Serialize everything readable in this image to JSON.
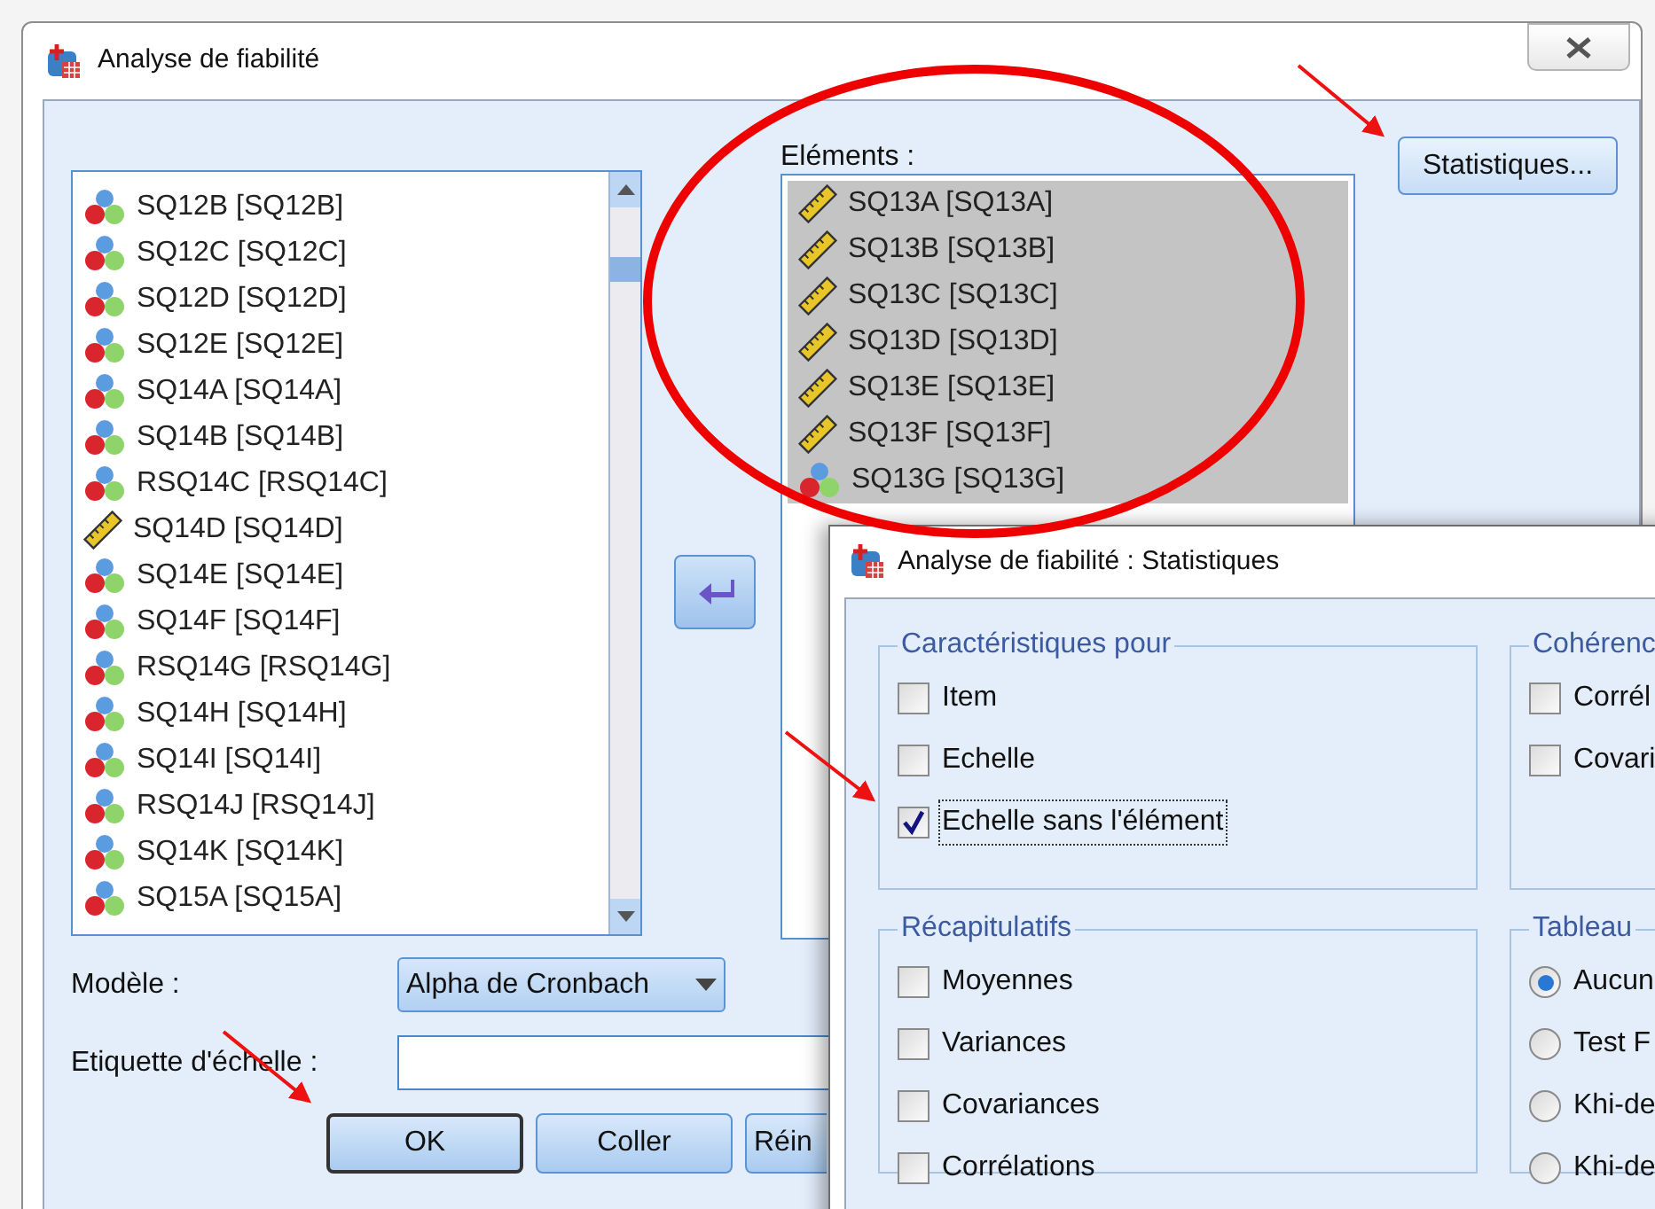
{
  "window": {
    "title": "Analyse de fiabilité"
  },
  "variables": {
    "items": [
      {
        "label": "SQ12B [SQ12B]",
        "kind": "nominal",
        "selected": false
      },
      {
        "label": "SQ12C [SQ12C]",
        "kind": "nominal",
        "selected": false
      },
      {
        "label": "SQ12D [SQ12D]",
        "kind": "nominal",
        "selected": false
      },
      {
        "label": "SQ12E [SQ12E]",
        "kind": "nominal",
        "selected": false
      },
      {
        "label": "SQ14A [SQ14A]",
        "kind": "nominal",
        "selected": false
      },
      {
        "label": "SQ14B [SQ14B]",
        "kind": "nominal",
        "selected": false
      },
      {
        "label": "RSQ14C [RSQ14C]",
        "kind": "nominal",
        "selected": false
      },
      {
        "label": "SQ14D [SQ14D]",
        "kind": "scale",
        "selected": false
      },
      {
        "label": "SQ14E [SQ14E]",
        "kind": "nominal",
        "selected": false
      },
      {
        "label": "SQ14F [SQ14F]",
        "kind": "nominal",
        "selected": false
      },
      {
        "label": "RSQ14G [RSQ14G]",
        "kind": "nominal",
        "selected": false
      },
      {
        "label": "SQ14H [SQ14H]",
        "kind": "nominal",
        "selected": false
      },
      {
        "label": "SQ14I [SQ14I]",
        "kind": "nominal",
        "selected": false
      },
      {
        "label": "RSQ14J [RSQ14J]",
        "kind": "nominal",
        "selected": false
      },
      {
        "label": "SQ14K [SQ14K]",
        "kind": "nominal",
        "selected": false
      },
      {
        "label": "SQ15A [SQ15A]",
        "kind": "nominal",
        "selected": false
      }
    ]
  },
  "elements": {
    "label": "Eléments :",
    "items": [
      {
        "label": "SQ13A [SQ13A]",
        "kind": "scale",
        "selected": true
      },
      {
        "label": "SQ13B [SQ13B]",
        "kind": "scale",
        "selected": true
      },
      {
        "label": "SQ13C [SQ13C]",
        "kind": "scale",
        "selected": true
      },
      {
        "label": "SQ13D [SQ13D]",
        "kind": "scale",
        "selected": true
      },
      {
        "label": "SQ13E [SQ13E]",
        "kind": "scale",
        "selected": true
      },
      {
        "label": "SQ13F [SQ13F]",
        "kind": "scale",
        "selected": true
      },
      {
        "label": "SQ13G [SQ13G]",
        "kind": "nominal",
        "selected": true
      }
    ]
  },
  "statistics_button": "Statistiques...",
  "model": {
    "label": "Modèle :",
    "value": "Alpha de Cronbach"
  },
  "scale_label": {
    "label": "Etiquette d'échelle :"
  },
  "buttons": [
    {
      "label": "OK",
      "default": true
    },
    {
      "label": "Coller",
      "default": false
    },
    {
      "label": "Réin",
      "default": false
    }
  ],
  "statistics_dialog": {
    "title": "Analyse de fiabilité : Statistiques",
    "groups": [
      {
        "title": "Caractéristiques pour",
        "options": [
          {
            "label": "Item",
            "kind": "checkbox",
            "checked": false,
            "focused": false
          },
          {
            "label": "Echelle",
            "kind": "checkbox",
            "checked": false,
            "focused": false
          },
          {
            "label": "Echelle sans l'élément",
            "kind": "checkbox",
            "checked": true,
            "focused": true
          }
        ]
      },
      {
        "title": "Cohérenc",
        "options": [
          {
            "label": "Corrél",
            "kind": "checkbox",
            "checked": false,
            "focused": false
          },
          {
            "label": "Covari",
            "kind": "checkbox",
            "checked": false,
            "focused": false
          }
        ]
      },
      {
        "title": "Récapitulatifs",
        "options": [
          {
            "label": "Moyennes",
            "kind": "checkbox",
            "checked": false,
            "focused": false
          },
          {
            "label": "Variances",
            "kind": "checkbox",
            "checked": false,
            "focused": false
          },
          {
            "label": "Covariances",
            "kind": "checkbox",
            "checked": false,
            "focused": false
          },
          {
            "label": "Corrélations",
            "kind": "checkbox",
            "checked": false,
            "focused": false
          }
        ]
      },
      {
        "title": "Tableau",
        "options": [
          {
            "label": "Aucun",
            "kind": "radio",
            "selected": true,
            "focused": false
          },
          {
            "label": "Test F",
            "kind": "radio",
            "selected": false,
            "focused": false
          },
          {
            "label": "Khi-de",
            "kind": "radio",
            "selected": false,
            "focused": false
          },
          {
            "label": "Khi-de",
            "kind": "radio",
            "selected": false,
            "focused": false
          }
        ]
      }
    ]
  }
}
